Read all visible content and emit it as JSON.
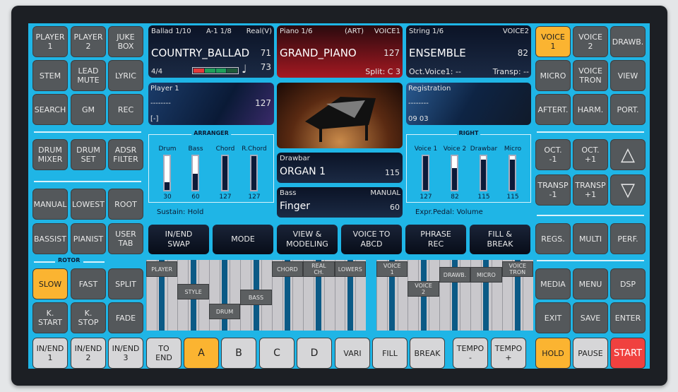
{
  "colors": {
    "screen": "#1fb5e6",
    "button": "#54585b",
    "active": "#fbb431",
    "start": "#f0413f"
  },
  "left_buttons": [
    "PLAYER\n1",
    "PLAYER\n2",
    "JUKE\nBOX",
    "STEM",
    "LEAD\nMUTE",
    "LYRIC",
    "SEARCH",
    "GM",
    "REC",
    "DRUM\nMIXER",
    "DRUM\nSET",
    "ADSR\nFILTER",
    "MANUAL",
    "LOWEST",
    "ROOT",
    "BASSIST",
    "PIANIST",
    "USER\nTAB",
    "SLOW",
    "FAST",
    "SPLIT",
    "K.\nSTART",
    "K.\nSTOP",
    "FADE"
  ],
  "rotor_label": "ROTOR",
  "right_buttons": [
    "VOICE\n1",
    "VOICE\n2",
    "DRAWB.",
    "MICRO",
    "VOICE\nTRON",
    "VIEW",
    "AFTERT.",
    "HARM.",
    "PORT.",
    "OCT.\n-1",
    "OCT.\n+1",
    "△",
    "TRANSP\n-1",
    "TRANSP\n+1",
    "▽",
    "REGS.",
    "MULTI",
    "PERF.",
    "MEDIA",
    "MENU",
    "DSP",
    "EXIT",
    "SAVE",
    "ENTER"
  ],
  "bottom_buttons": [
    "IN/END\n1",
    "IN/END\n2",
    "IN/END\n3",
    "TO\nEND",
    "A",
    "B",
    "C",
    "D",
    "VARI",
    "FILL",
    "BREAK",
    "TEMPO\n-",
    "TEMPO\n+",
    "HOLD",
    "PAUSE",
    "START"
  ],
  "style": {
    "bank": "Ballad 1/10",
    "variation": "A-1 1/8",
    "mode": "Real(V)",
    "name": "COUNTRY_BALLAD",
    "value": "71",
    "time_sig": "4/4",
    "tempo": "73",
    "beat_indicator": [
      "red",
      "green",
      "green",
      "green"
    ],
    "note_icon": "quarter-note-icon"
  },
  "voice1": {
    "bank": "Piano 1/6",
    "art": "(ART)",
    "tag": "VOICE1",
    "name": "GRAND_PIANO",
    "value": "127",
    "split": "Split: C 3"
  },
  "voice2": {
    "bank": "String 1/6",
    "tag": "VOICE2",
    "name": "ENSEMBLE",
    "value": "82",
    "oct": "Oct.Voice1: --",
    "transp": "Transp: --"
  },
  "player": {
    "title": "Player 1",
    "song": "--------",
    "value": "127",
    "status": "[-]"
  },
  "registration": {
    "title": "Registration",
    "name": "--------",
    "number": "09 03"
  },
  "arranger": {
    "title": "ARRANGER",
    "channels": [
      {
        "label": "Drum",
        "value": 30
      },
      {
        "label": "Bass",
        "value": 60
      },
      {
        "label": "Chord",
        "value": 127
      },
      {
        "label": "R.Chord",
        "value": 127
      }
    ],
    "max": 127,
    "sustain": "Sustain: Hold"
  },
  "right": {
    "title": "RIGHT",
    "channels": [
      {
        "label": "Voice 1",
        "value": 127
      },
      {
        "label": "Voice 2",
        "value": 82
      },
      {
        "label": "Drawbar",
        "value": 115
      },
      {
        "label": "Micro",
        "value": 115
      }
    ],
    "max": 127,
    "expr": "Expr.Pedal: Volume"
  },
  "drawbar": {
    "title": "Drawbar",
    "name": "ORGAN 1",
    "value": "115"
  },
  "bass": {
    "title": "Bass",
    "mode": "MANUAL",
    "name": "Finger",
    "value": "60"
  },
  "function_buttons": [
    "IN/END\nSWAP",
    "MODE",
    "VIEW &\nMODELING",
    "VOICE TO\nABCD",
    "PHRASE\nREC",
    "FILL &\nBREAK"
  ],
  "left_mixer": [
    "PLAYER",
    "STYLE",
    "DRUM",
    "BASS",
    "CHORD",
    "REAL\nCH.",
    "LOWERS"
  ],
  "right_mixer": [
    "VOICE\n1",
    "VOICE\n2",
    "DRAWB.",
    "MICRO",
    "VOICE\nTRON"
  ]
}
